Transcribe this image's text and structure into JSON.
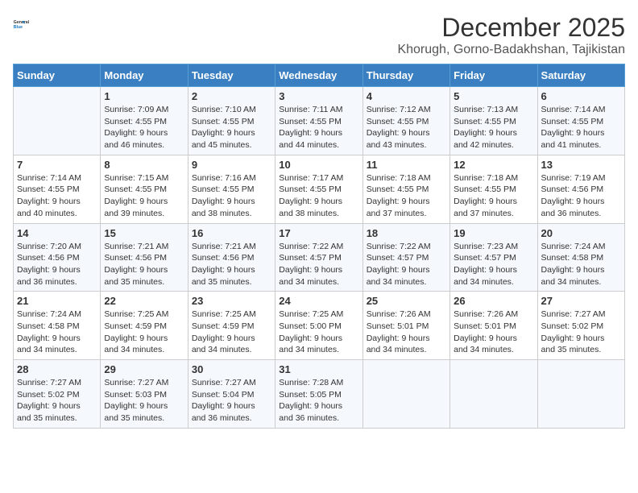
{
  "logo": {
    "line1": "General",
    "line2": "Blue"
  },
  "header": {
    "month": "December 2025",
    "location": "Khorugh, Gorno-Badakhshan, Tajikistan"
  },
  "weekdays": [
    "Sunday",
    "Monday",
    "Tuesday",
    "Wednesday",
    "Thursday",
    "Friday",
    "Saturday"
  ],
  "weeks": [
    [
      {
        "day": "",
        "info": ""
      },
      {
        "day": "1",
        "info": "Sunrise: 7:09 AM\nSunset: 4:55 PM\nDaylight: 9 hours\nand 46 minutes."
      },
      {
        "day": "2",
        "info": "Sunrise: 7:10 AM\nSunset: 4:55 PM\nDaylight: 9 hours\nand 45 minutes."
      },
      {
        "day": "3",
        "info": "Sunrise: 7:11 AM\nSunset: 4:55 PM\nDaylight: 9 hours\nand 44 minutes."
      },
      {
        "day": "4",
        "info": "Sunrise: 7:12 AM\nSunset: 4:55 PM\nDaylight: 9 hours\nand 43 minutes."
      },
      {
        "day": "5",
        "info": "Sunrise: 7:13 AM\nSunset: 4:55 PM\nDaylight: 9 hours\nand 42 minutes."
      },
      {
        "day": "6",
        "info": "Sunrise: 7:14 AM\nSunset: 4:55 PM\nDaylight: 9 hours\nand 41 minutes."
      }
    ],
    [
      {
        "day": "7",
        "info": "Sunrise: 7:14 AM\nSunset: 4:55 PM\nDaylight: 9 hours\nand 40 minutes."
      },
      {
        "day": "8",
        "info": "Sunrise: 7:15 AM\nSunset: 4:55 PM\nDaylight: 9 hours\nand 39 minutes."
      },
      {
        "day": "9",
        "info": "Sunrise: 7:16 AM\nSunset: 4:55 PM\nDaylight: 9 hours\nand 38 minutes."
      },
      {
        "day": "10",
        "info": "Sunrise: 7:17 AM\nSunset: 4:55 PM\nDaylight: 9 hours\nand 38 minutes."
      },
      {
        "day": "11",
        "info": "Sunrise: 7:18 AM\nSunset: 4:55 PM\nDaylight: 9 hours\nand 37 minutes."
      },
      {
        "day": "12",
        "info": "Sunrise: 7:18 AM\nSunset: 4:55 PM\nDaylight: 9 hours\nand 37 minutes."
      },
      {
        "day": "13",
        "info": "Sunrise: 7:19 AM\nSunset: 4:56 PM\nDaylight: 9 hours\nand 36 minutes."
      }
    ],
    [
      {
        "day": "14",
        "info": "Sunrise: 7:20 AM\nSunset: 4:56 PM\nDaylight: 9 hours\nand 36 minutes."
      },
      {
        "day": "15",
        "info": "Sunrise: 7:21 AM\nSunset: 4:56 PM\nDaylight: 9 hours\nand 35 minutes."
      },
      {
        "day": "16",
        "info": "Sunrise: 7:21 AM\nSunset: 4:56 PM\nDaylight: 9 hours\nand 35 minutes."
      },
      {
        "day": "17",
        "info": "Sunrise: 7:22 AM\nSunset: 4:57 PM\nDaylight: 9 hours\nand 34 minutes."
      },
      {
        "day": "18",
        "info": "Sunrise: 7:22 AM\nSunset: 4:57 PM\nDaylight: 9 hours\nand 34 minutes."
      },
      {
        "day": "19",
        "info": "Sunrise: 7:23 AM\nSunset: 4:57 PM\nDaylight: 9 hours\nand 34 minutes."
      },
      {
        "day": "20",
        "info": "Sunrise: 7:24 AM\nSunset: 4:58 PM\nDaylight: 9 hours\nand 34 minutes."
      }
    ],
    [
      {
        "day": "21",
        "info": "Sunrise: 7:24 AM\nSunset: 4:58 PM\nDaylight: 9 hours\nand 34 minutes."
      },
      {
        "day": "22",
        "info": "Sunrise: 7:25 AM\nSunset: 4:59 PM\nDaylight: 9 hours\nand 34 minutes."
      },
      {
        "day": "23",
        "info": "Sunrise: 7:25 AM\nSunset: 4:59 PM\nDaylight: 9 hours\nand 34 minutes."
      },
      {
        "day": "24",
        "info": "Sunrise: 7:25 AM\nSunset: 5:00 PM\nDaylight: 9 hours\nand 34 minutes."
      },
      {
        "day": "25",
        "info": "Sunrise: 7:26 AM\nSunset: 5:01 PM\nDaylight: 9 hours\nand 34 minutes."
      },
      {
        "day": "26",
        "info": "Sunrise: 7:26 AM\nSunset: 5:01 PM\nDaylight: 9 hours\nand 34 minutes."
      },
      {
        "day": "27",
        "info": "Sunrise: 7:27 AM\nSunset: 5:02 PM\nDaylight: 9 hours\nand 35 minutes."
      }
    ],
    [
      {
        "day": "28",
        "info": "Sunrise: 7:27 AM\nSunset: 5:02 PM\nDaylight: 9 hours\nand 35 minutes."
      },
      {
        "day": "29",
        "info": "Sunrise: 7:27 AM\nSunset: 5:03 PM\nDaylight: 9 hours\nand 35 minutes."
      },
      {
        "day": "30",
        "info": "Sunrise: 7:27 AM\nSunset: 5:04 PM\nDaylight: 9 hours\nand 36 minutes."
      },
      {
        "day": "31",
        "info": "Sunrise: 7:28 AM\nSunset: 5:05 PM\nDaylight: 9 hours\nand 36 minutes."
      },
      {
        "day": "",
        "info": ""
      },
      {
        "day": "",
        "info": ""
      },
      {
        "day": "",
        "info": ""
      }
    ]
  ]
}
